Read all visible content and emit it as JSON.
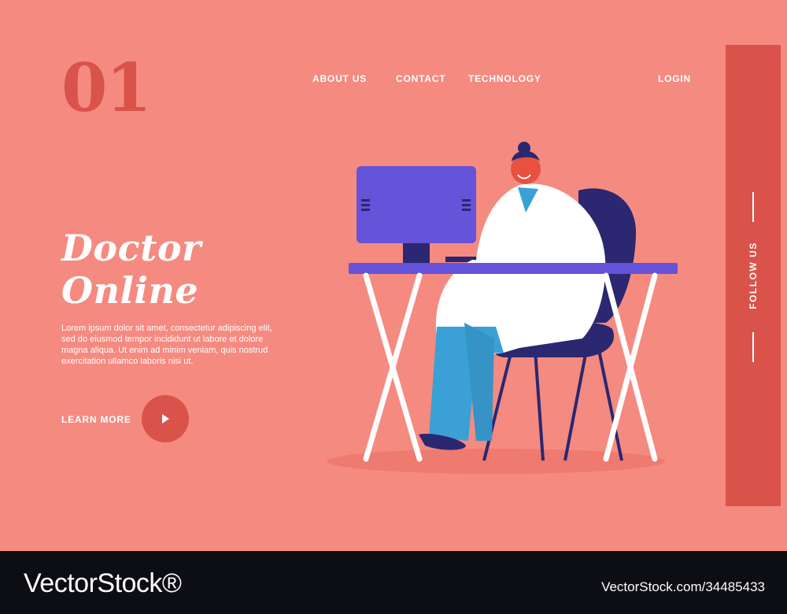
{
  "page_number": "01",
  "nav": {
    "about": "ABOUT US",
    "contact": "CONTACT",
    "technology": "TECHNOLOGY",
    "login": "LOGIN"
  },
  "hero": {
    "title_line1": "Doctor",
    "title_line2": "Online",
    "body": "Lorem ipsum dolor sit amet, consectetur adipiscing elit, sed do eiusmod tempor incididunt ut labore et dolore magna aliqua. Ut enim ad minim veniam, quis nostrud exercitation ullamco laboris nisi ut.",
    "cta_label": "LEARN MORE"
  },
  "sidebar": {
    "follow_label": "FOLLOW US"
  },
  "watermark": {
    "brand": "VectorStock®",
    "id": "VectorStock.com/34485433"
  },
  "colors": {
    "background": "#f58a80",
    "accent": "#d9534a",
    "text": "#ffffff",
    "monitor": "#6553d9",
    "chair": "#2b2770",
    "pants": "#3aa0d6"
  },
  "icons": {
    "play": "play-icon"
  }
}
